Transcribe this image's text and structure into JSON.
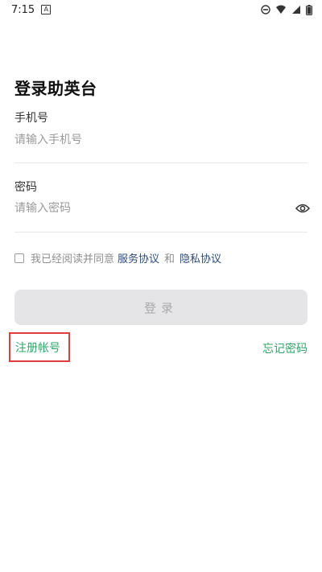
{
  "status_bar": {
    "time": "7:15",
    "notification_icon": "app-notification-icon",
    "icons": [
      "dnd-icon",
      "wifi-icon",
      "cell-signal-icon",
      "battery-icon"
    ]
  },
  "page": {
    "title": "登录助英台"
  },
  "phone": {
    "label": "手机号",
    "placeholder": "请输入手机号",
    "value": ""
  },
  "password": {
    "label": "密码",
    "placeholder": "请输入密码",
    "value": "",
    "toggle_icon": "eye-icon"
  },
  "agreement": {
    "checked": false,
    "prefix": "我已经阅读并同意",
    "service_link": "服务协议",
    "and": "和",
    "privacy_link": "隐私协议"
  },
  "login_button": {
    "label": "登录"
  },
  "links": {
    "register": "注册帐号",
    "forgot": "忘记密码"
  },
  "colors": {
    "accent_green": "#35a46a",
    "link_blue": "#2f4c7e",
    "disabled_button_bg": "#e5e5e8",
    "highlight_red": "#e23b3b"
  }
}
